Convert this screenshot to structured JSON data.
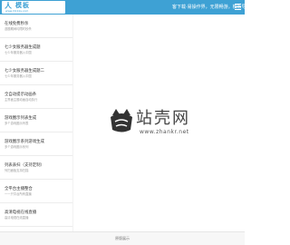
{
  "header": {
    "logo_mark": "人",
    "logo_text": "模板",
    "logo_url": "www.ih11ks.com",
    "slogan": "客下载·易操作界，无限畅游，模板导航"
  },
  "sidebar": {
    "items": [
      {
        "title": "在线免费秒杀",
        "sub": "选题期间均限时秒杀"
      },
      {
        "title": "七少女服务器生成题",
        "sub": "七少年服务器入中国"
      },
      {
        "title": "七少女服务器生成题二",
        "sub": "七少年服务器入中国"
      },
      {
        "title": "全自动提示动画条",
        "sub": "主界面主题动画自动执行"
      },
      {
        "title": "游戏圈示列表生成",
        "sub": "多个游戏圈示列表"
      },
      {
        "title": "游戏圈示系列游戏生成",
        "sub": "多个游戏圈示系列"
      },
      {
        "title": "列表表扫（支持定制）",
        "sub": "列扫面板支持扫描"
      },
      {
        "title": "全平台主播整合",
        "sub": "一一只平台所有直播"
      },
      {
        "title": "高清电视在线直播",
        "sub": "高清电视在线直播"
      }
    ]
  },
  "watermark": {
    "cn": "站壳网",
    "url": "www.zhankr.net"
  },
  "footer": {
    "text": "原版展示"
  },
  "colors": {
    "header_bg": "#3ea1d4",
    "footer_bg": "#f7f7f7"
  }
}
